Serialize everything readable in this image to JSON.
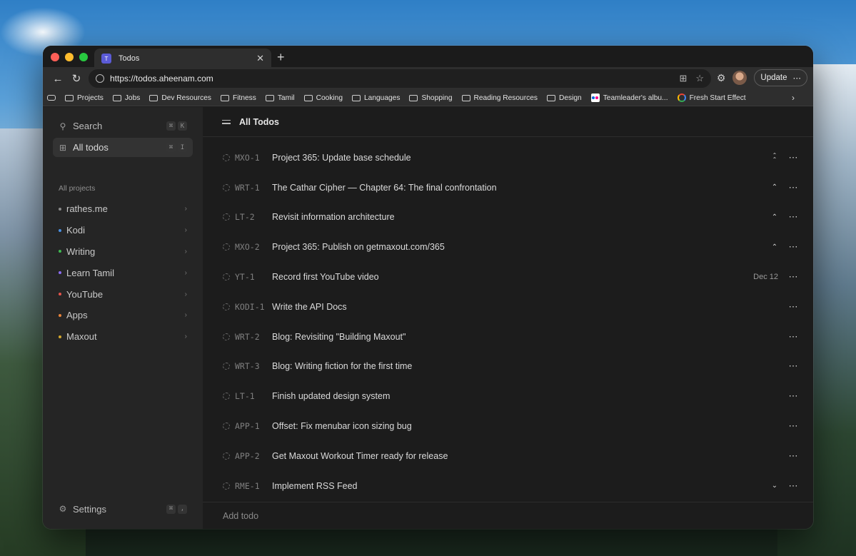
{
  "browser": {
    "tab_title": "Todos",
    "tab_favicon": "T",
    "url": "https://todos.aheenam.com",
    "update_label": "Update",
    "bookmarks": [
      {
        "label": "Projects",
        "icon": "folder-icon"
      },
      {
        "label": "Jobs",
        "icon": "folder-icon"
      },
      {
        "label": "Dev Resources",
        "icon": "folder-icon"
      },
      {
        "label": "Fitness",
        "icon": "folder-icon"
      },
      {
        "label": "Tamil",
        "icon": "folder-icon"
      },
      {
        "label": "Cooking",
        "icon": "folder-icon"
      },
      {
        "label": "Languages",
        "icon": "folder-icon"
      },
      {
        "label": "Shopping",
        "icon": "folder-icon"
      },
      {
        "label": "Reading Resources",
        "icon": "folder-icon"
      },
      {
        "label": "Design",
        "icon": "folder-icon"
      },
      {
        "label": "Teamleader's albu...",
        "icon": "flickr-icon"
      },
      {
        "label": "Fresh Start Effect",
        "icon": "google-icon"
      }
    ]
  },
  "sidebar": {
    "search_label": "Search",
    "search_shortcut": [
      "⌘",
      "K"
    ],
    "all_todos_label": "All todos",
    "all_todos_shortcut": [
      "⌘",
      "I"
    ],
    "projects_title": "All projects",
    "projects": [
      {
        "label": "rathes.me",
        "color": "#8a8a8a"
      },
      {
        "label": "Kodi",
        "color": "#4a90e2"
      },
      {
        "label": "Writing",
        "color": "#3fb950"
      },
      {
        "label": "Learn Tamil",
        "color": "#8b6cf0"
      },
      {
        "label": "YouTube",
        "color": "#e5534b"
      },
      {
        "label": "Apps",
        "color": "#e8833a"
      },
      {
        "label": "Maxout",
        "color": "#d4a72c"
      }
    ],
    "settings_label": "Settings",
    "settings_shortcut": [
      "⌘",
      ","
    ]
  },
  "main": {
    "title": "All Todos",
    "add_placeholder": "Add todo",
    "todos": [
      {
        "id": "MXO-1",
        "title": "Project 365: Update base schedule",
        "date": "",
        "priority": "urgent-icon"
      },
      {
        "id": "WRT-1",
        "title": "The Cathar Cipher — Chapter 64: The final confrontation",
        "date": "",
        "priority": "high-icon"
      },
      {
        "id": "LT-2",
        "title": "Revisit information architecture",
        "date": "",
        "priority": "high-icon"
      },
      {
        "id": "MXO-2",
        "title": "Project 365: Publish on getmaxout.com/365",
        "date": "",
        "priority": "high-icon"
      },
      {
        "id": "YT-1",
        "title": "Record first YouTube video",
        "date": "Dec 12",
        "priority": ""
      },
      {
        "id": "KODI-1",
        "title": "Write the API Docs",
        "date": "",
        "priority": ""
      },
      {
        "id": "WRT-2",
        "title": "Blog: Revisiting \"Building Maxout\"",
        "date": "",
        "priority": ""
      },
      {
        "id": "WRT-3",
        "title": "Blog: Writing fiction for the first time",
        "date": "",
        "priority": ""
      },
      {
        "id": "LT-1",
        "title": "Finish updated design system",
        "date": "",
        "priority": ""
      },
      {
        "id": "APP-1",
        "title": "Offset: Fix menubar icon sizing bug",
        "date": "",
        "priority": ""
      },
      {
        "id": "APP-2",
        "title": "Get Maxout Workout Timer ready for release",
        "date": "",
        "priority": ""
      },
      {
        "id": "RME-1",
        "title": "Implement RSS Feed",
        "date": "",
        "priority": "low-icon"
      }
    ]
  }
}
